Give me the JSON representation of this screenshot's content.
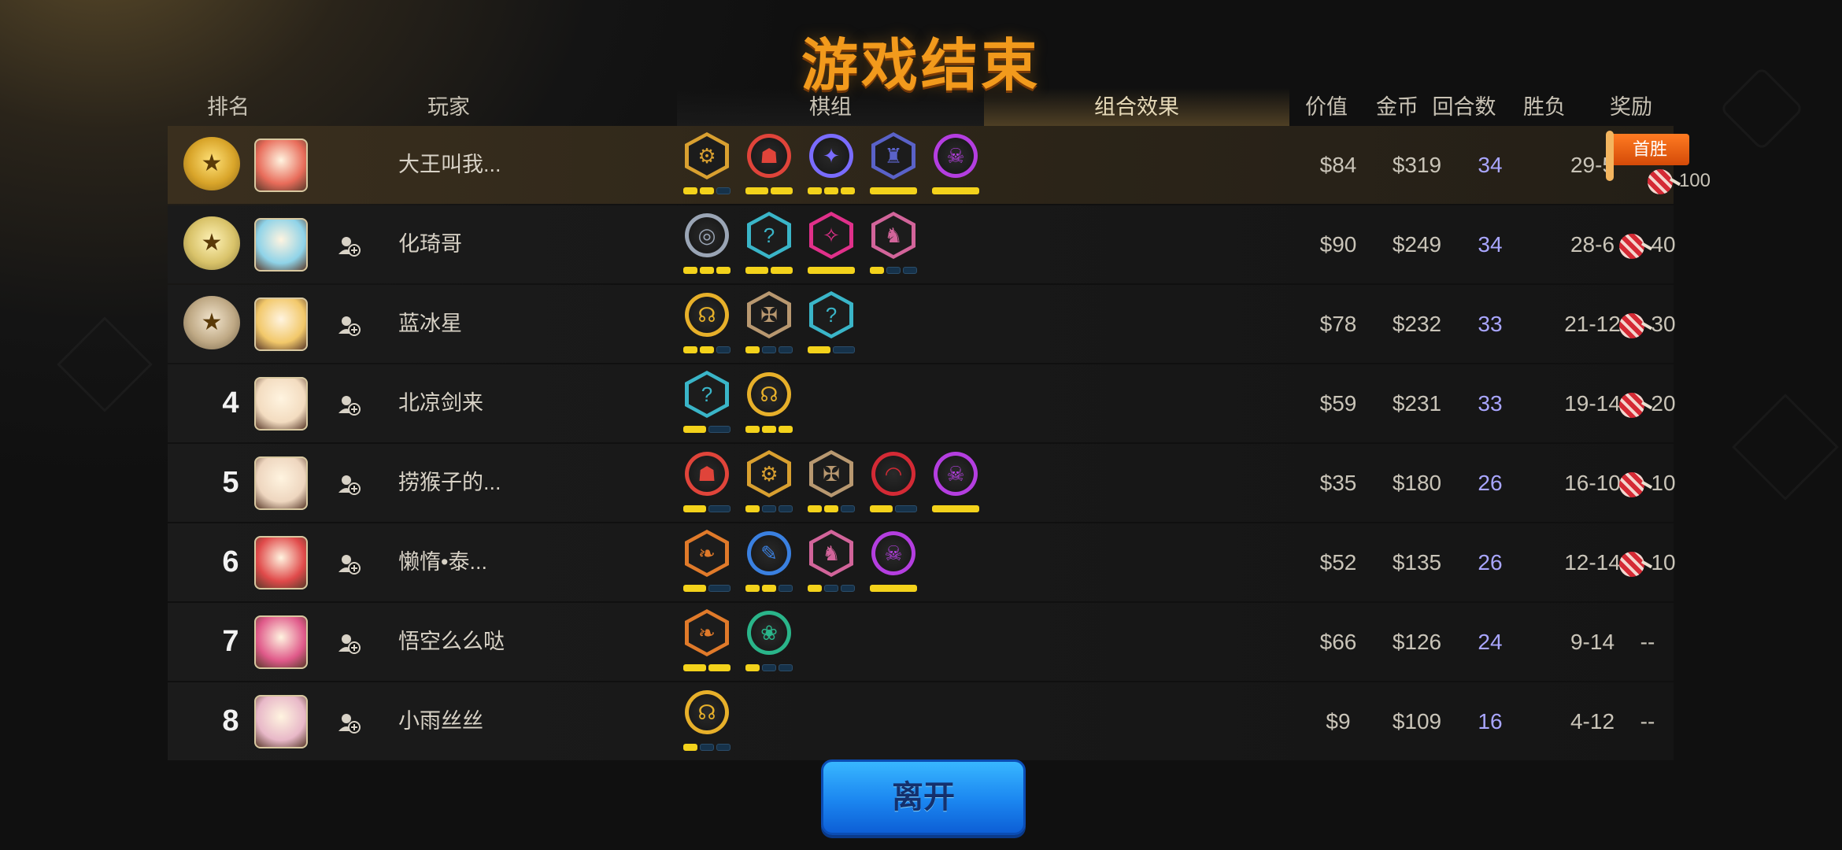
{
  "title": "游戏结束",
  "headers": {
    "rank": "排名",
    "player": "玩家",
    "chess": "棋组",
    "combo": "组合效果",
    "value": "价值",
    "gold": "金币",
    "rounds": "回合数",
    "winloss": "胜负",
    "reward": "奖励"
  },
  "rows": [
    {
      "rank": "",
      "medal": "gold",
      "avatar_color": "#e86c5a",
      "name": "大王叫我...",
      "value": "$84",
      "gold": "$319",
      "rounds": "34",
      "wl": "29-5",
      "reward": "100",
      "first_win": "首胜",
      "chess": [
        {
          "c": "#d9a030",
          "g": "⚙",
          "b": [
            1,
            1,
            0
          ]
        },
        {
          "c": "#e0443a",
          "g": "☗",
          "b": [
            1,
            1
          ]
        },
        {
          "c": "#7a6cff",
          "g": "✦",
          "b": [
            1,
            1,
            1
          ]
        },
        {
          "c": "#5a62c8",
          "g": "♜",
          "b": [
            1
          ]
        },
        {
          "c": "#b43ee0",
          "g": "☠",
          "b": [
            1
          ]
        }
      ]
    },
    {
      "rank": "",
      "medal": "silver",
      "avatar_color": "#8fd3e8",
      "name": "化琦哥",
      "value": "$90",
      "gold": "$249",
      "rounds": "34",
      "wl": "28-6",
      "reward": "40",
      "chess": [
        {
          "c": "#9aa5b5",
          "g": "◎",
          "b": [
            1,
            1,
            1
          ]
        },
        {
          "c": "#3ab5c8",
          "g": "?",
          "b": [
            1,
            1
          ]
        },
        {
          "c": "#e0308a",
          "g": "✧",
          "b": [
            1
          ]
        },
        {
          "c": "#d2649a",
          "g": "♞",
          "b": [
            1,
            0,
            0
          ]
        }
      ]
    },
    {
      "rank": "",
      "medal": "bronze",
      "avatar_color": "#f2c86a",
      "name": "蓝冰星",
      "value": "$78",
      "gold": "$232",
      "rounds": "33",
      "wl": "21-12",
      "reward": "30",
      "chess": [
        {
          "c": "#e7b02a",
          "g": "☊",
          "b": [
            1,
            1,
            0
          ]
        },
        {
          "c": "#b89870",
          "g": "✠",
          "b": [
            1,
            0,
            0
          ]
        },
        {
          "c": "#3ab5c8",
          "g": "?",
          "b": [
            1,
            0
          ]
        }
      ]
    },
    {
      "rank": "4",
      "medal": "",
      "avatar_color": "#f3dcc0",
      "name": "北凉剑来",
      "value": "$59",
      "gold": "$231",
      "rounds": "33",
      "wl": "19-14",
      "reward": "20",
      "chess": [
        {
          "c": "#3ab5c8",
          "g": "?",
          "b": [
            1,
            0
          ]
        },
        {
          "c": "#e7b02a",
          "g": "☊",
          "b": [
            1,
            1,
            1
          ]
        }
      ]
    },
    {
      "rank": "5",
      "medal": "",
      "avatar_color": "#eed6bf",
      "name": "捞猴子的...",
      "value": "$35",
      "gold": "$180",
      "rounds": "26",
      "wl": "16-10",
      "reward": "10",
      "chess": [
        {
          "c": "#e0443a",
          "g": "☗",
          "b": [
            1,
            0
          ]
        },
        {
          "c": "#d9a030",
          "g": "⚙",
          "b": [
            1,
            0,
            0
          ]
        },
        {
          "c": "#b89870",
          "g": "✠",
          "b": [
            1,
            1,
            0
          ]
        },
        {
          "c": "#d42a35",
          "g": "◠",
          "b": [
            1,
            0
          ]
        },
        {
          "c": "#b43ee0",
          "g": "☠",
          "b": [
            1
          ]
        }
      ]
    },
    {
      "rank": "6",
      "medal": "",
      "avatar_color": "#e04a4a",
      "name": "懒惰•泰...",
      "value": "$52",
      "gold": "$135",
      "rounds": "26",
      "wl": "12-14",
      "reward": "10",
      "chess": [
        {
          "c": "#e07a2a",
          "g": "❧",
          "b": [
            1,
            0
          ]
        },
        {
          "c": "#3a80e0",
          "g": "✎",
          "b": [
            1,
            1,
            0
          ]
        },
        {
          "c": "#d2649a",
          "g": "♞",
          "b": [
            1,
            0,
            0
          ]
        },
        {
          "c": "#b43ee0",
          "g": "☠",
          "b": [
            1
          ]
        }
      ]
    },
    {
      "rank": "7",
      "medal": "",
      "avatar_color": "#e05a8a",
      "name": "悟空么么哒",
      "value": "$66",
      "gold": "$126",
      "rounds": "24",
      "wl": "9-14",
      "reward": "--",
      "chess": [
        {
          "c": "#e07a2a",
          "g": "❧",
          "b": [
            1,
            1
          ]
        },
        {
          "c": "#2ab58a",
          "g": "❀",
          "b": [
            1,
            0,
            0
          ]
        }
      ]
    },
    {
      "rank": "8",
      "medal": "",
      "avatar_color": "#e8b8c8",
      "name": "小雨丝丝",
      "value": "$9",
      "gold": "$109",
      "rounds": "16",
      "wl": "4-12",
      "reward": "--",
      "chess": [
        {
          "c": "#e7b02a",
          "g": "☊",
          "b": [
            1,
            0,
            0
          ]
        }
      ]
    }
  ],
  "leave_label": "离开"
}
